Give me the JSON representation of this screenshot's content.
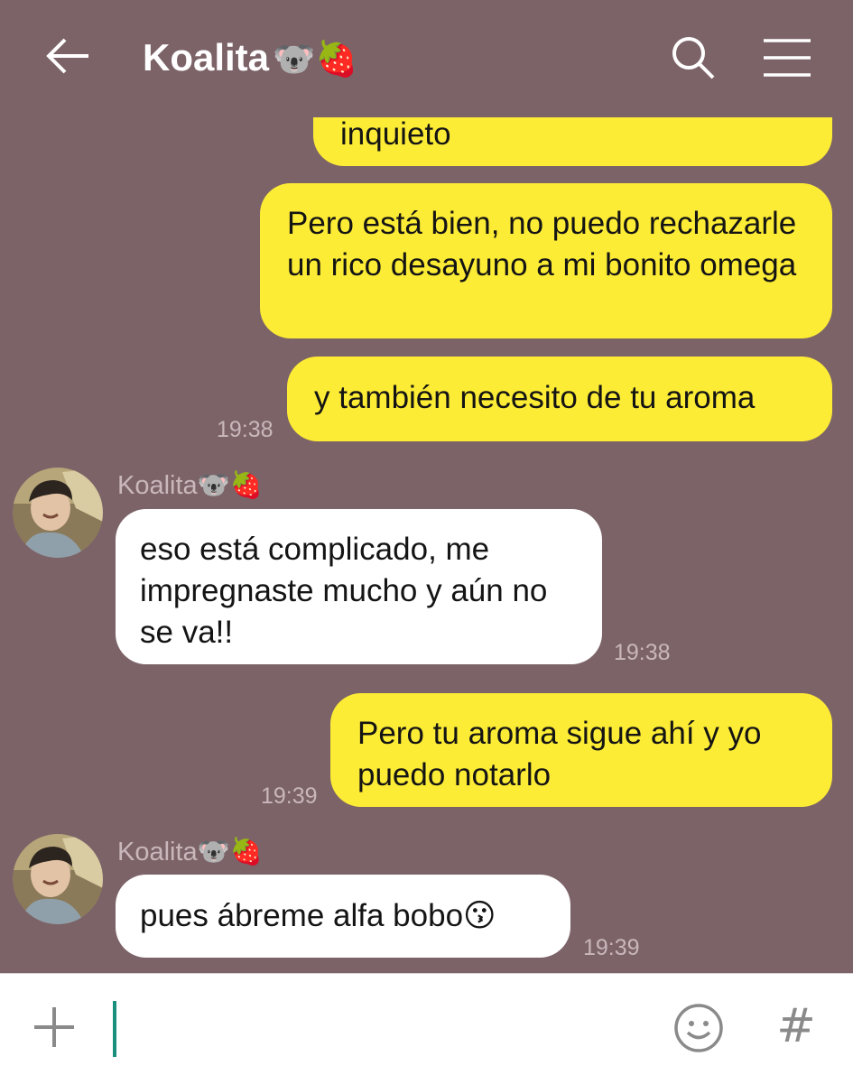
{
  "header": {
    "title": "Koalita",
    "title_emoji": "🐨🍓"
  },
  "messages": [
    {
      "side": "out",
      "text": "inquieto",
      "time": ""
    },
    {
      "side": "out",
      "text": "Pero está bien, no puedo rechazarle un rico desayuno a mi bonito omega",
      "time": ""
    },
    {
      "side": "out",
      "text": "y también necesito de tu aroma",
      "time": "19:38"
    },
    {
      "side": "in",
      "sender": "Koalita🐨🍓",
      "text": "eso está complicado, me impregnaste mucho y aún no se va!!",
      "time": "19:38"
    },
    {
      "side": "out",
      "text": "Pero tu aroma sigue ahí y yo puedo notarlo",
      "time": "19:39"
    },
    {
      "side": "in",
      "sender": "Koalita🐨🍓",
      "text": "pues ábreme alfa bobo😗",
      "time": "19:39"
    }
  ],
  "input": {
    "value": "",
    "hash_label": "#"
  },
  "colors": {
    "background": "#7c6368",
    "outgoing_bubble": "#fdec35",
    "incoming_bubble": "#ffffff",
    "caret": "#1a8f7e"
  },
  "icons": [
    "back-arrow-icon",
    "search-icon",
    "menu-icon",
    "plus-icon",
    "emoji-icon",
    "hash-icon",
    "avatar"
  ]
}
